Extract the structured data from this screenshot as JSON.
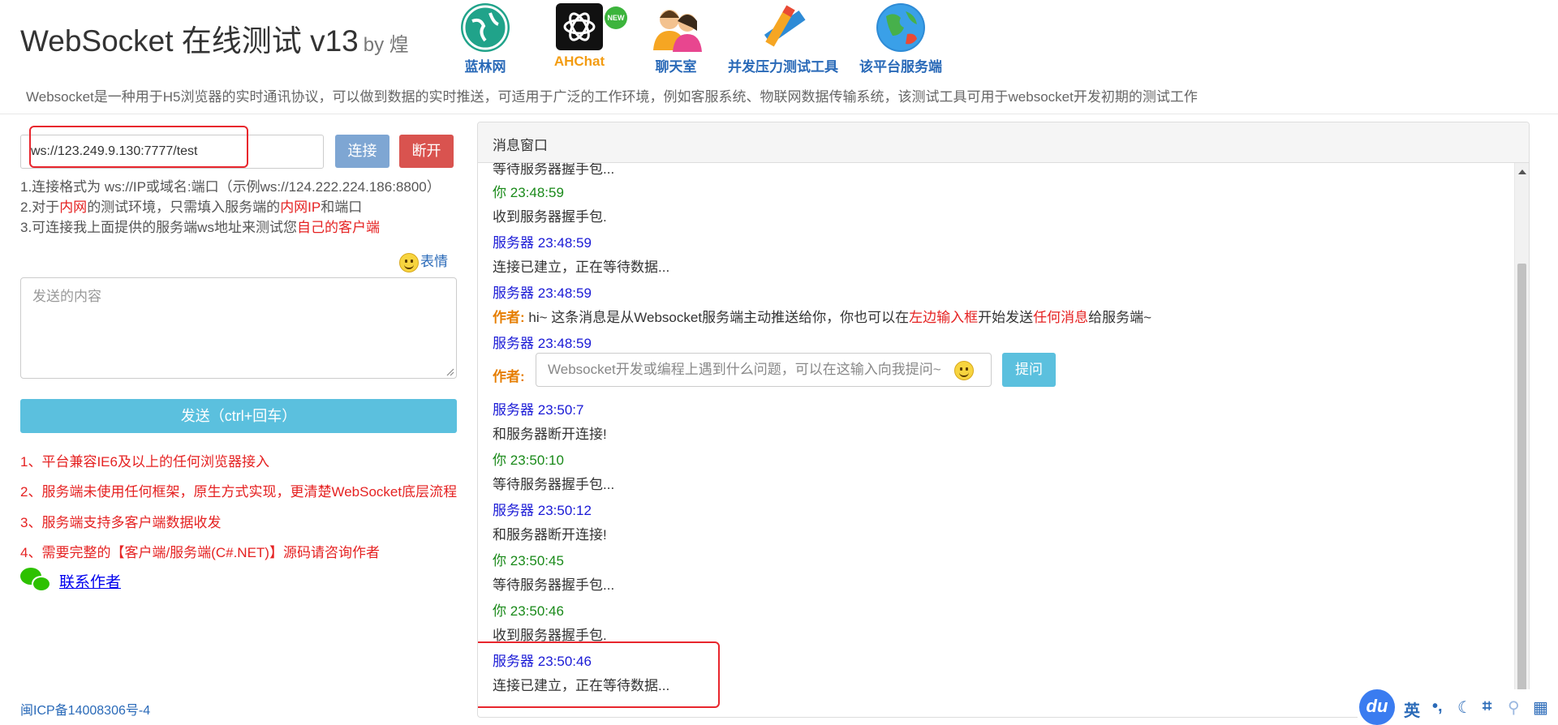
{
  "header": {
    "title": "WebSocket 在线测试 v13",
    "by": "by 煌",
    "subtitle": "Websocket是一种用于H5浏览器的实时通讯协议，可以做到数据的实时推送，可适用于广泛的工作环境，例如客服系统、物联网数据传输系统，该测试工具可用于websocket开发初期的测试工作",
    "links": [
      {
        "label": "蓝林网",
        "icon": "globe-icon",
        "color": "#20a38a"
      },
      {
        "label": "AHChat",
        "icon": "openai-icon",
        "color": "#111111",
        "badge": "NEW"
      },
      {
        "label": "聊天室",
        "icon": "users-icon",
        "color": "#f6a623"
      },
      {
        "label": "并发压力测试工具",
        "icon": "pencil-ruler-icon",
        "color": "#e94a35"
      },
      {
        "label": "该平台服务端",
        "icon": "earth-icon",
        "color": "#2e8bd6"
      }
    ]
  },
  "connection": {
    "url": "ws://123.249.9.130:7777/test",
    "connect_label": "连接",
    "disconnect_label": "断开",
    "tip1": "1.连接格式为 ws://IP或域名:端口（示例ws://124.222.224.186:8800）",
    "tip2_pre": "2.对于",
    "tip2_red1": "内网",
    "tip2_mid": "的测试环境，只需填入服务端的",
    "tip2_red2": "内网IP",
    "tip2_post": "和端口",
    "tip3_pre": "3.可连接我上面提供的服务端ws地址来测试您",
    "tip3_red": "自己的客户端"
  },
  "compose": {
    "emoji_label": "表情",
    "placeholder": "发送的内容",
    "send_label": "发送（ctrl+回车）"
  },
  "features": [
    "1、平台兼容IE6及以上的任何浏览器接入",
    "2、服务端未使用任何框架，原生方式实现，更清楚WebSocket底层流程",
    "3、服务端支持多客户端数据收发",
    "4、需要完整的【客户端/服务端(C#.NET)】源码请咨询作者"
  ],
  "contact_label": "联系作者",
  "icp": "闽ICP备14008306号-4",
  "panel": {
    "title": "消息窗口",
    "cut_text": "等待服务器握手包...",
    "messages": [
      {
        "sender": "你",
        "time": "23:48:59",
        "text": "收到服务器握手包."
      },
      {
        "sender": "服务器",
        "time": "23:48:59",
        "text": "连接已建立，正在等待数据..."
      },
      {
        "sender": "服务器",
        "time": "23:48:59",
        "author": "作者:",
        "text_pre": "hi~ 这条消息是从Websocket服务端主动推送给你，你也可以在",
        "text_red1": "左边输入框",
        "text_mid": "开始发送",
        "text_red2": "任何消息",
        "text_post": "给服务端~"
      },
      {
        "sender": "服务器",
        "time": "23:48:59",
        "author": "作者:",
        "ask_placeholder": "Websocket开发或编程上遇到什么问题，可以在这输入向我提问~",
        "ask_label": "提问"
      },
      {
        "sender": "服务器",
        "time": "23:50:7",
        "text": "和服务器断开连接!"
      },
      {
        "sender": "你",
        "time": "23:50:10",
        "text": "等待服务器握手包..."
      },
      {
        "sender": "服务器",
        "time": "23:50:12",
        "text": "和服务器断开连接!"
      },
      {
        "sender": "你",
        "time": "23:50:45",
        "text": "等待服务器握手包..."
      },
      {
        "sender": "你",
        "time": "23:50:46",
        "text": "收到服务器握手包."
      },
      {
        "sender": "服务器",
        "time": "23:50:46",
        "text": "连接已建立，正在等待数据..."
      }
    ]
  },
  "ime": {
    "logo": "du",
    "lang": "英",
    "punct": "•,",
    "moon": "☾",
    "crop": "⌗",
    "user": "⚲",
    "grid": "▦"
  }
}
